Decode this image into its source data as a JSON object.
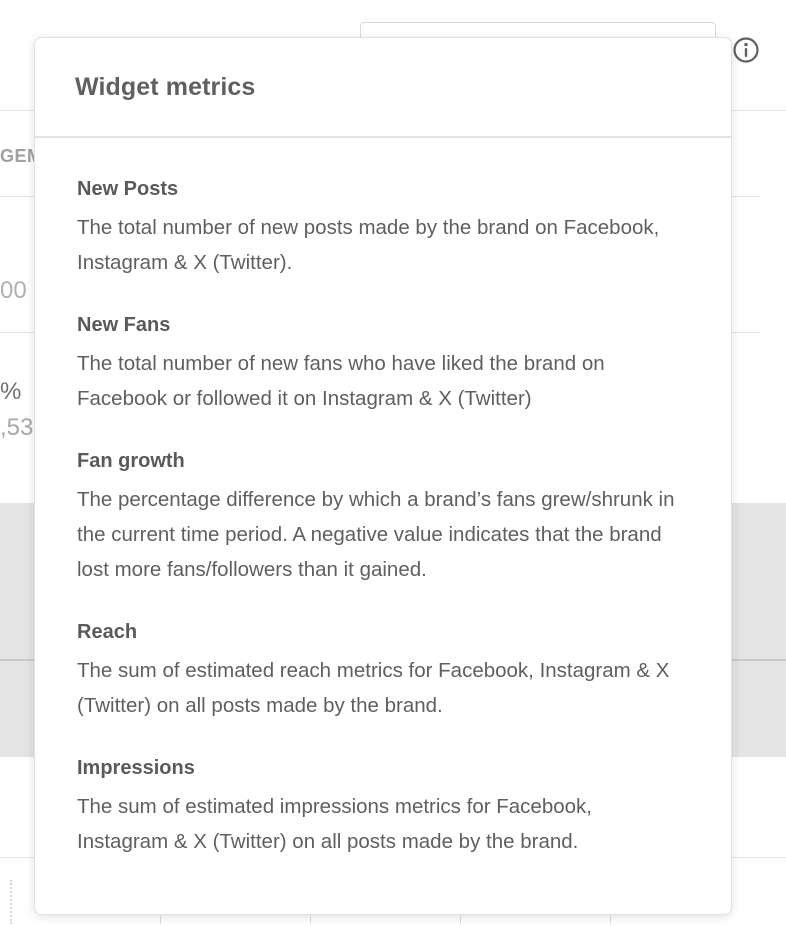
{
  "background": {
    "column_header_fragment": "GEM",
    "value_fragment_1": "00",
    "value_fragment_2": "%",
    "value_fragment_3": ",53"
  },
  "icons": {
    "info": "info-circle-icon"
  },
  "popover": {
    "title": "Widget metrics",
    "metrics": [
      {
        "name": "New Posts",
        "description": "The total number of new posts made by the brand on Facebook, Instagram & X (Twitter)."
      },
      {
        "name": "New Fans",
        "description": "The total number of new fans who have liked the brand on Facebook or followed it on Instagram & X (Twitter)"
      },
      {
        "name": "Fan growth",
        "description": "The percentage difference by which a brand’s fans grew/shrunk in the current time period. A negative value indicates that the brand lost more fans/followers than it gained."
      },
      {
        "name": "Reach",
        "description": "The sum of estimated reach metrics for Facebook, Instagram & X (Twitter) on all posts made by the brand."
      },
      {
        "name": "Impressions",
        "description": "The sum of estimated impressions metrics for Facebook, Instagram & X (Twitter) on all posts made by the brand."
      }
    ]
  }
}
